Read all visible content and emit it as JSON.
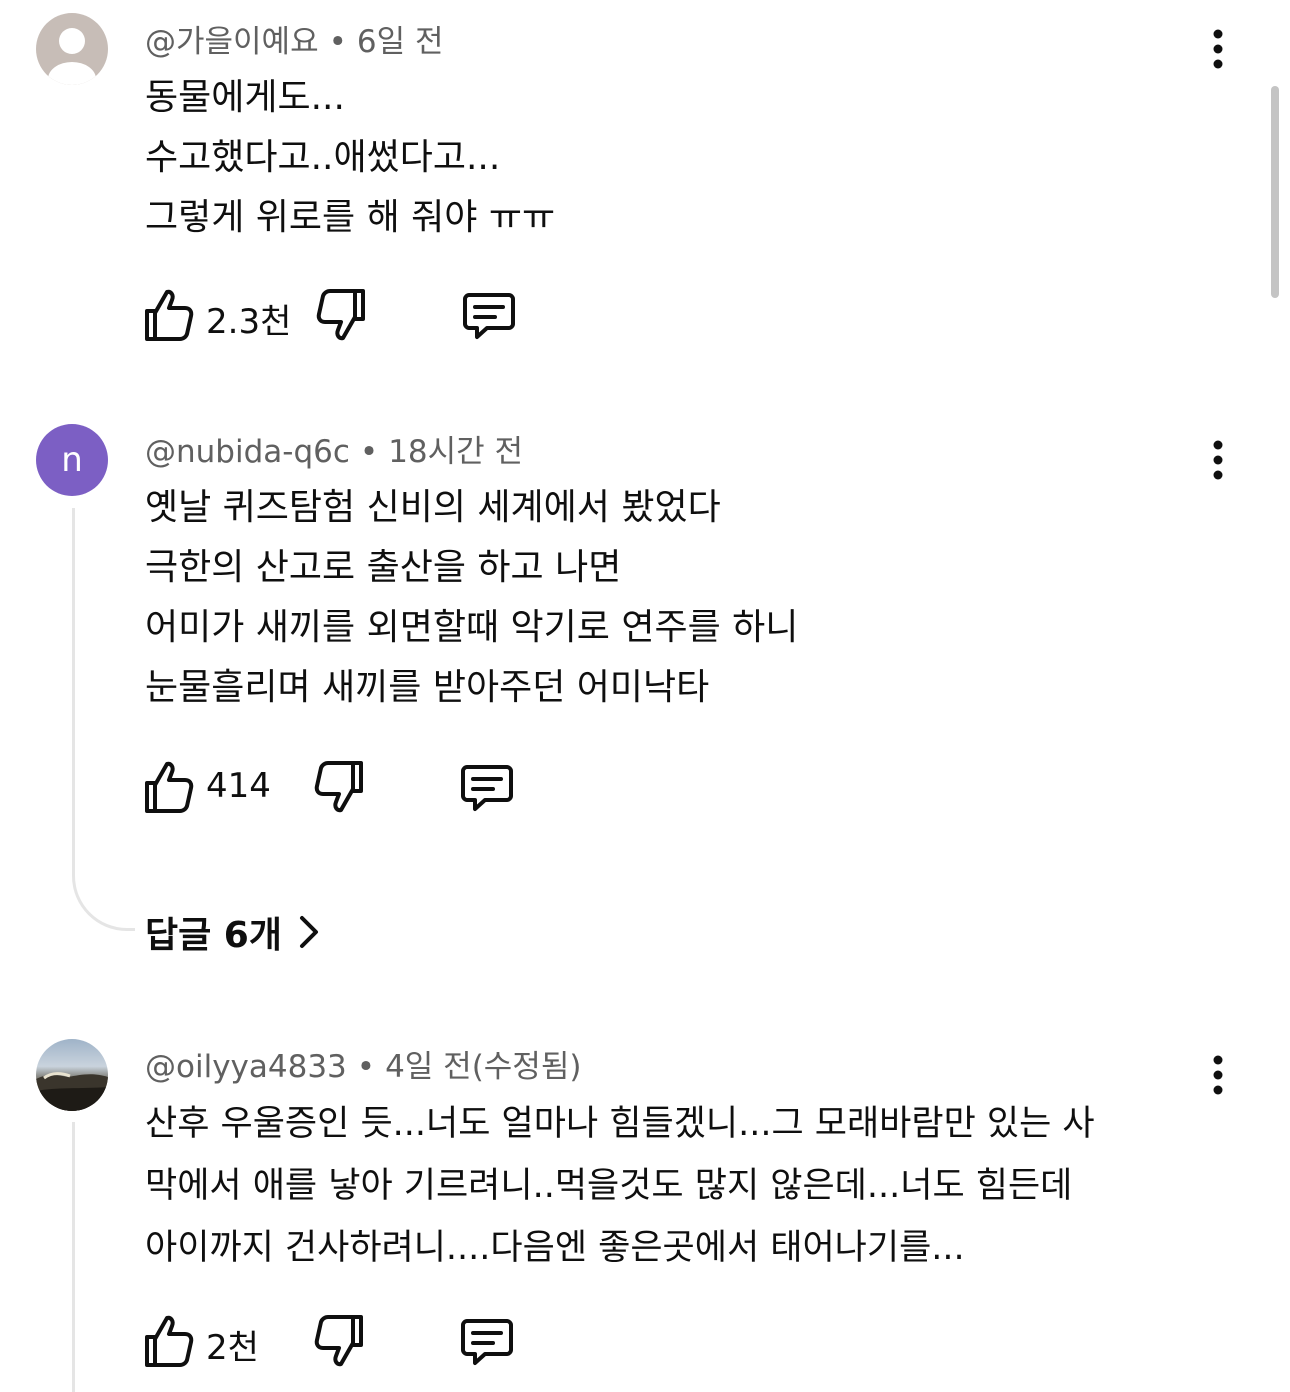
{
  "comments": [
    {
      "author": "@가을이예요",
      "time": "6일 전",
      "lines": [
        "동물에게도...",
        "수고했다고..애썼다고...",
        "그렇게 위로를 해 줘야 ㅠㅠ"
      ],
      "likes": "2.3천",
      "avatar": "default-avatar"
    },
    {
      "author": "@nubida-q6c",
      "time": "18시간 전",
      "avatar_letter": "n",
      "lines": [
        "옛날 퀴즈탐험 신비의 세계에서 봤었다",
        "극한의 산고로 출산을 하고 나면",
        "어미가 새끼를 외면할때 악기로 연주를 하니",
        "눈물흘리며 새끼를 받아주던 어미낙타"
      ],
      "likes": "414",
      "replies_label": "답글 6개"
    },
    {
      "author": "@oilyya4833",
      "time": "4일 전(수정됨)",
      "lines": [
        "산후 우울증인 듯...너도 얼마나 힘들겠니...그 모래바람만 있는 사",
        "막에서 애를 낳아 기르려니..먹을것도 많지 않은데...너도 힘든데",
        "아이까지 건사하려니....다음엔 좋은곳에서 태어나기를..."
      ],
      "likes": "2천",
      "avatar": "landscape-photo"
    }
  ],
  "meta_separator": "•",
  "colors": {
    "text": "#0f0f0f",
    "meta": "#606060",
    "avatar_purple": "#7c5fc4",
    "thread_line": "#e5e5e5"
  },
  "icons": [
    "like-icon",
    "dislike-icon",
    "reply-icon",
    "more-options-icon",
    "chevron-right-icon"
  ]
}
